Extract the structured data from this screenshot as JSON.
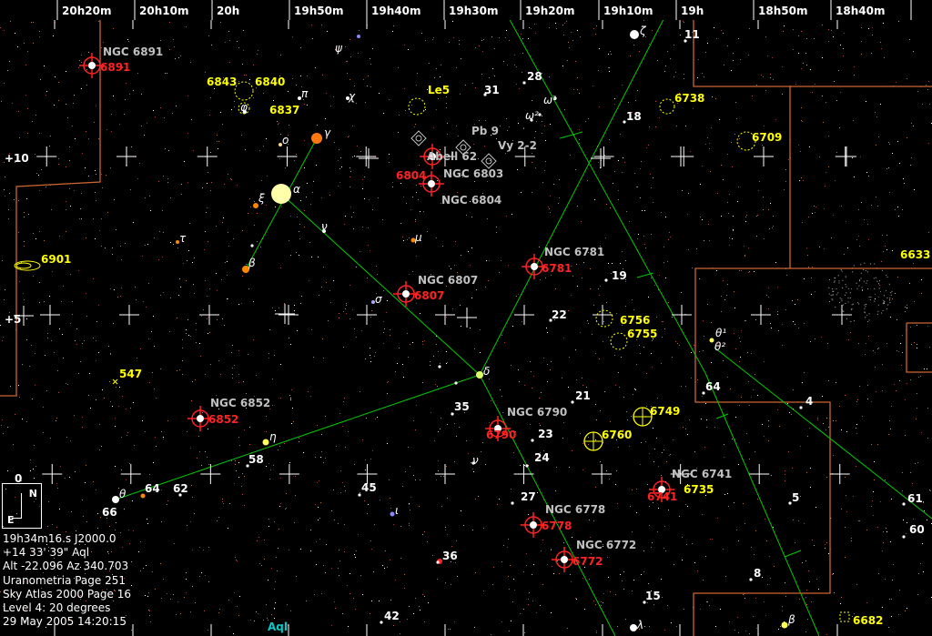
{
  "ra_labels": [
    "20h20m",
    "20h10m",
    "20h",
    "19h50m",
    "19h40m",
    "19h30m",
    "19h20m",
    "19h10m",
    "19h",
    "18h50m",
    "18h40m"
  ],
  "dec_labels": [
    "+10",
    "+5",
    "0"
  ],
  "constellation_label": "Aql",
  "compass": {
    "north": "N",
    "east": "E"
  },
  "info": {
    "ra": "19h34m16.s  J2000.0",
    "dec": "+14 33' 39\"      Aql",
    "altaz": "Alt -22.096  Az 340.703",
    "uranometria": "Uranometria Page 251",
    "skyatlas": "Sky Atlas 2000 Page 16",
    "level": "Level 4: 20 degrees",
    "datetime": "29 May 2005 14:20:15"
  },
  "labels": {
    "ngc6891_name": "NGC 6891",
    "ngc6891_num": "6891",
    "ngc6852_name": "NGC 6852",
    "ngc6852_num": "6852",
    "ngc6807_name": "NGC 6807",
    "ngc6807_num": "6807",
    "ngc6781_name": "NGC 6781",
    "ngc6781_num": "6781",
    "ngc6790_name": "NGC 6790",
    "ngc6790_num": "6790",
    "ngc6778_name": "NGC 6778",
    "ngc6778_num": "6778",
    "ngc6772_name": "NGC 6772",
    "ngc6772_num": "6772",
    "ngc6741_name": "NGC 6741",
    "ngc6741_num": "6741",
    "ngc6803_name": "NGC 6803",
    "ngc6804_name": "NGC 6804",
    "ngc6804_num": "6804",
    "abell62": "Abell 62",
    "pb9": "Pb 9",
    "vy22": "Vy 2-2",
    "y6843": "6843",
    "y6840": "6840",
    "y6837": "6837",
    "le5": "Le5",
    "y6738": "6738",
    "y6709": "6709",
    "y6901": "6901",
    "y6633": "6633",
    "y547": "547",
    "y6756": "6756",
    "y6755": "6755",
    "y6749": "6749",
    "y6760": "6760",
    "y6735": "6735",
    "y6682": "6682",
    "w31": "31",
    "w28": "28",
    "w18": "18",
    "w11": "11",
    "w19": "19",
    "w22": "22",
    "w21": "21",
    "w23": "23",
    "w24": "24",
    "w27": "27",
    "w35": "35",
    "w58": "58",
    "w64a": "64",
    "w62": "62",
    "w66": "66",
    "w45": "45",
    "w36": "36",
    "w42": "42",
    "w15": "15",
    "w8": "8",
    "w5": "5",
    "w64b": "64",
    "w4": "4",
    "w61": "61",
    "w60": "60",
    "omega1": "ω¹",
    "omega2": "ω²",
    "gamma": "γ",
    "alpha": "α",
    "xi": "ξ",
    "beta": "β",
    "tau": "τ",
    "nu": "ν",
    "mu": "μ",
    "sigma": "σ",
    "delta": "δ",
    "eta": "η",
    "theta_aql": "θ",
    "iota": "ι",
    "nu2": "ν",
    "pi": "π",
    "chi": "χ",
    "psi": "ψ",
    "phi": "φ",
    "omicron": "ο",
    "theta1": "θ¹",
    "theta2": "θ²",
    "zeta": "ζ",
    "lambda": "λ",
    "beta_ser": "β"
  },
  "colors": {
    "background": "#000000",
    "grid": "#ffffff",
    "constellation_line": "#00cc00",
    "boundary": "#cc6633",
    "planetary_nebula": "#ff0000",
    "cluster": "#ffff00",
    "label_gray": "#c0c0c0",
    "star_white": "#ffffff",
    "star_orange": "#ff8800"
  }
}
